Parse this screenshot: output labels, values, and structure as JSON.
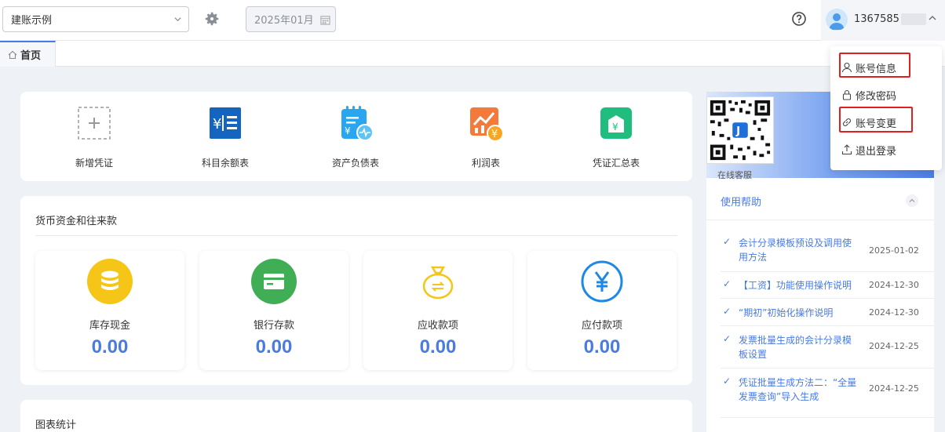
{
  "header": {
    "ledger_select": "建账示例",
    "period": "2025年01月",
    "username": "1367585"
  },
  "tabs": [
    {
      "label": "首页"
    }
  ],
  "quick_actions": [
    {
      "label": "新增凭证",
      "icon": "add-voucher-icon"
    },
    {
      "label": "科目余额表",
      "icon": "account-balance-icon"
    },
    {
      "label": "资产负债表",
      "icon": "balance-sheet-icon"
    },
    {
      "label": "利润表",
      "icon": "profit-statement-icon"
    },
    {
      "label": "凭证汇总表",
      "icon": "voucher-summary-icon"
    }
  ],
  "money_section": {
    "title": "货币资金和往来款",
    "stats": [
      {
        "label": "库存现金",
        "value": "0.00",
        "color": "#f5c518"
      },
      {
        "label": "银行存款",
        "value": "0.00",
        "color": "#3fae54"
      },
      {
        "label": "应收款项",
        "value": "0.00",
        "color": "#f5c518"
      },
      {
        "label": "应付款项",
        "value": "0.00",
        "color": "#1e88e5"
      }
    ]
  },
  "chart_section": {
    "title": "图表统计"
  },
  "right_panel": {
    "qr_label": "在线客服",
    "help_title": "使用帮助",
    "help_items": [
      {
        "title": "会计分录模板预设及调用使用方法",
        "date": "2025-01-02"
      },
      {
        "title": "【工资】功能使用操作说明",
        "date": "2024-12-30"
      },
      {
        "title": "“期初”初始化操作说明",
        "date": "2024-12-30"
      },
      {
        "title": "发票批量生成的会计分录模板设置",
        "date": "2024-12-25"
      },
      {
        "title": "凭证批量生成方法二：“全量发票查询”导入生成",
        "date": "2024-12-25"
      }
    ]
  },
  "user_menu": {
    "items": [
      {
        "label": "账号信息",
        "icon": "user-icon"
      },
      {
        "label": "修改密码",
        "icon": "lock-icon"
      },
      {
        "label": "账号变更",
        "icon": "link-icon"
      },
      {
        "label": "退出登录",
        "icon": "logout-icon"
      }
    ]
  },
  "colors": {
    "accent": "#4a7be0",
    "highlight": "#e02020"
  }
}
